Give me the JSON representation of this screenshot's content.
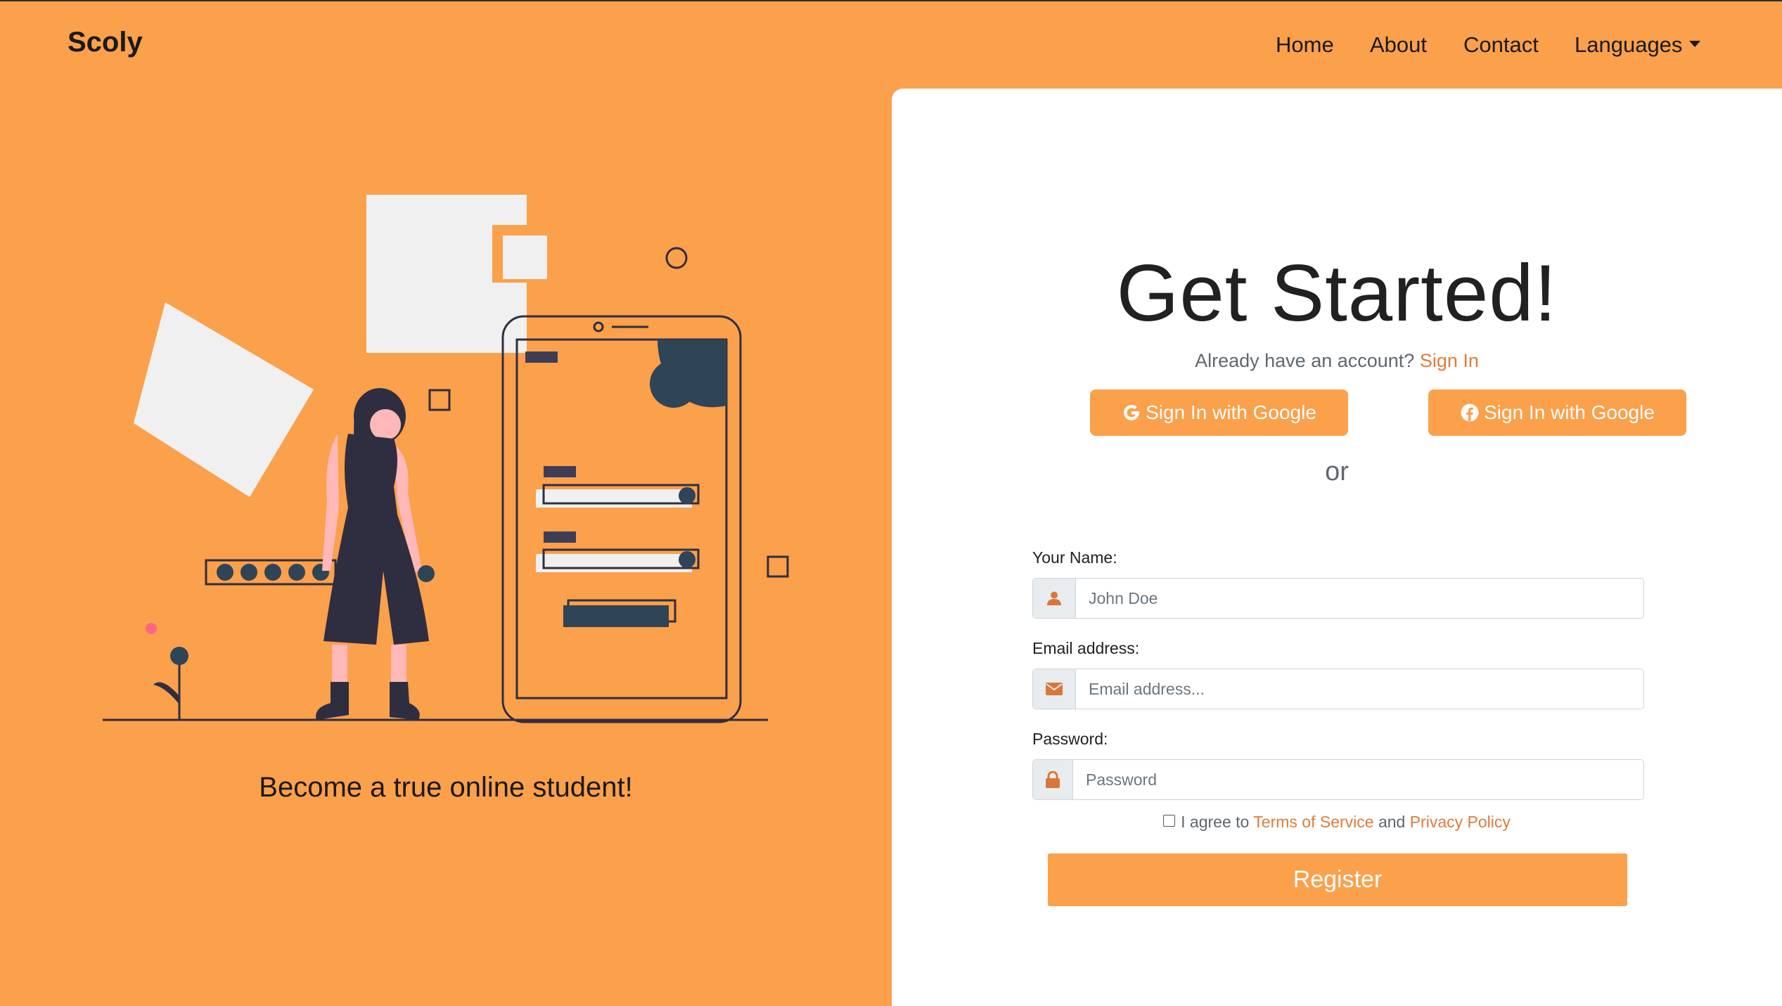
{
  "navbar": {
    "brand": "Scoly",
    "links": [
      {
        "label": "Home"
      },
      {
        "label": "About"
      },
      {
        "label": "Contact"
      },
      {
        "label": "Languages"
      }
    ]
  },
  "hero": {
    "tagline": "Become a true online student!"
  },
  "form": {
    "heading": "Get Started!",
    "already_text": "Already have an account?",
    "sign_in_link": "Sign In",
    "google_button": "Sign In with Google",
    "facebook_button": "Sign In with Google",
    "or_text": "or",
    "name_label": "Your Name:",
    "name_placeholder": "John Doe",
    "email_label": "Email address:",
    "email_placeholder": "Email address...",
    "password_label": "Password:",
    "password_placeholder": "Password",
    "terms_prefix": "I agree to",
    "terms_link": "Terms of Service",
    "terms_and": "and",
    "privacy_link": "Privacy Policy",
    "register_button": "Register"
  },
  "colors": {
    "accent": "#fba04b",
    "link": "#e07b3a",
    "icon": "#d9773b",
    "panel": "#ffffff"
  },
  "icons": {
    "name_field": "user-icon",
    "email_field": "envelope-icon",
    "password_field": "lock-icon",
    "google": "google-icon",
    "facebook": "facebook-icon",
    "languages": "caret-down-icon"
  }
}
